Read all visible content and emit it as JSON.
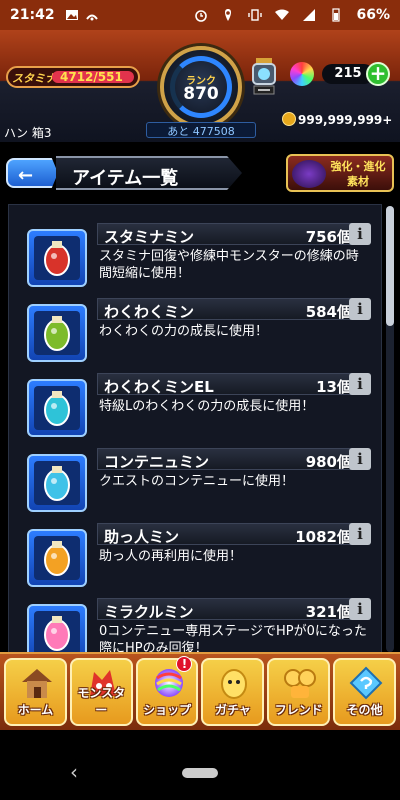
{
  "status_bar": {
    "time": "21:42",
    "battery": "66%",
    "left_icons": [
      "image-icon",
      "wifi-call-icon"
    ],
    "right_icons": [
      "alarm-icon",
      "location-icon",
      "vibrate-icon",
      "wifi-icon",
      "signal-icon",
      "battery-icon"
    ]
  },
  "header": {
    "stamina_label": "スタミナ",
    "stamina_value": "4712/551",
    "rank_label": "ランク",
    "rank_value": "870",
    "next_rank": "あと 477508",
    "orb_count": "215",
    "gold": "999,999,999+",
    "player_name": "ハン 箱3"
  },
  "title_bar": {
    "back_label": "←",
    "title": "アイテム一覧",
    "evolve_label": "強化・進化素材"
  },
  "scroll": {
    "position_fraction": 0.0
  },
  "items": [
    {
      "name": "スタミナミン",
      "count": "756個",
      "desc": "スタミナ回復や修練中モンスターの修練の時間短縮に使用！",
      "icon": "stamina-min-can-icon",
      "color": "#d8332a"
    },
    {
      "name": "わくわくミン",
      "count": "584個",
      "desc": "わくわくの力の成長に使用！",
      "icon": "wakuwaku-min-bottle-icon",
      "color": "#7dbb2b"
    },
    {
      "name": "わくわくミンEL",
      "count": "13個",
      "desc": "特級Lのわくわくの力の成長に使用！",
      "icon": "wakuwaku-min-el-bottle-icon",
      "color": "#2ec3d8"
    },
    {
      "name": "コンテニュミン",
      "count": "980個",
      "desc": "クエストのコンテニューに使用！",
      "icon": "continue-min-jar-icon",
      "color": "#3fc2e8"
    },
    {
      "name": "助っ人ミン",
      "count": "1082個",
      "desc": "助っ人の再利用に使用！",
      "icon": "helper-min-figure-icon",
      "color": "#f3a123"
    },
    {
      "name": "ミラクルミン",
      "count": "321個",
      "desc": "0コンテニュー専用ステージでHPが0になった際にHPのみ回復！",
      "icon": "miracle-min-heart-icon",
      "color": "#ff7ab8"
    }
  ],
  "nav": {
    "home": "ホーム",
    "monster": "モンスター",
    "shop": "ショップ",
    "shop_badge": "!",
    "gacha": "ガチャ",
    "friend": "フレンド",
    "other": "その他"
  },
  "system_nav": {
    "back": "‹"
  }
}
